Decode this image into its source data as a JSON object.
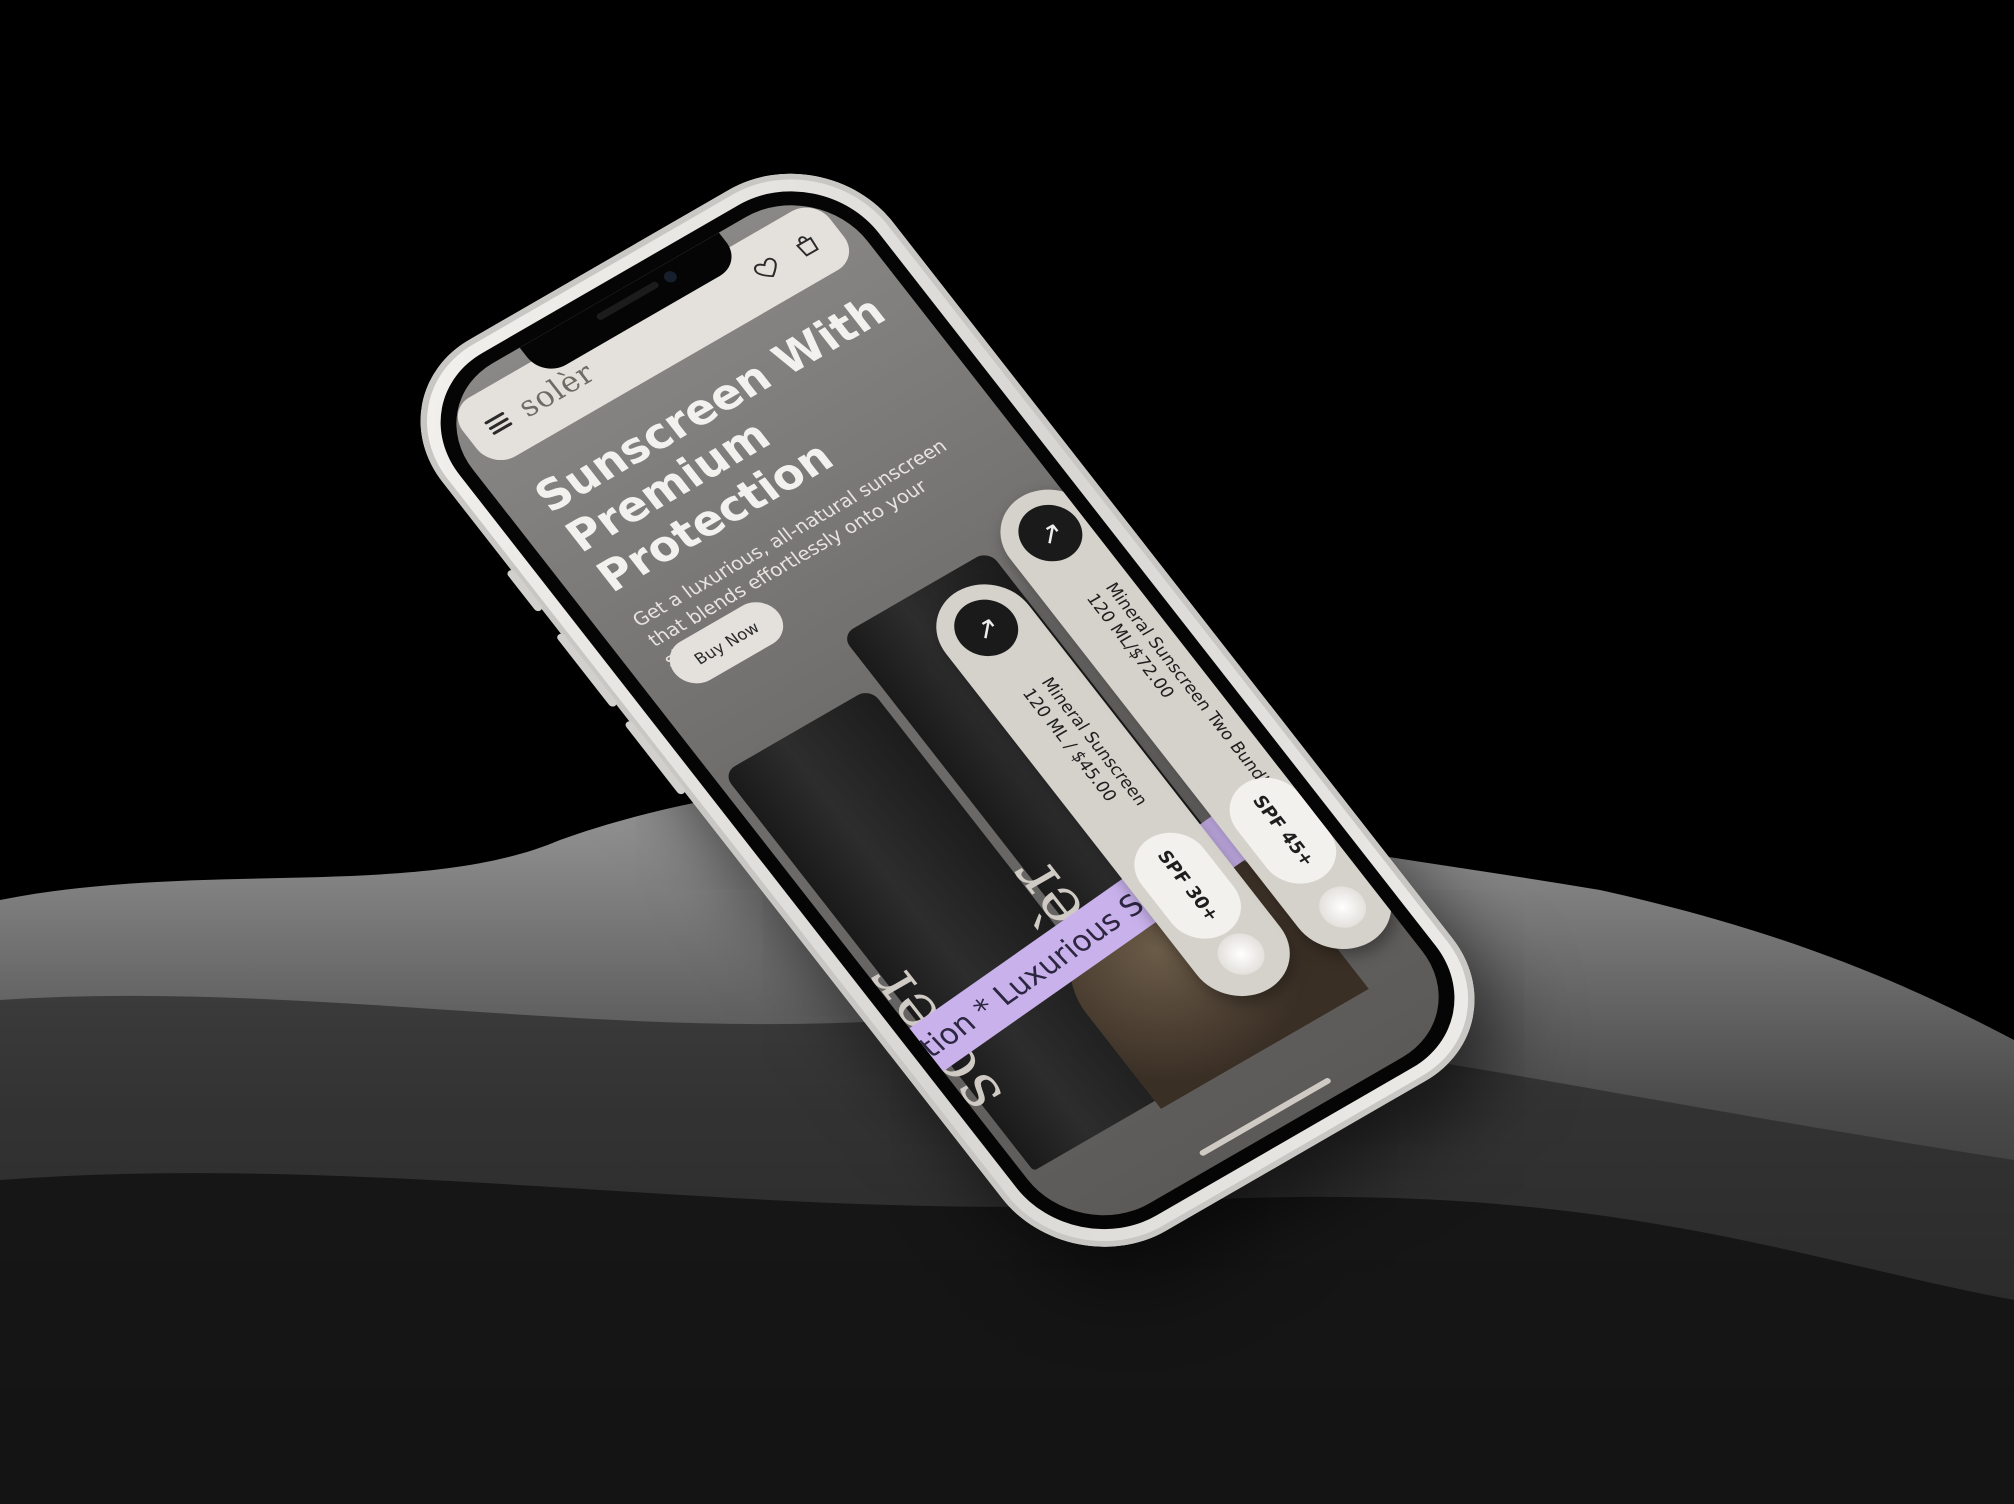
{
  "app": {
    "logo": "solèr"
  },
  "topbar": {
    "menu_icon": "hamburger-icon",
    "wishlist_icon": "heart-icon",
    "cart_icon": "shopping-bag-icon"
  },
  "hero": {
    "title": "Sunscreen With Premium Protection",
    "subtitle": "Get a luxurious, all-natural sunscreen that blends effortlessly onto your skin.",
    "cta_label": "Buy Now"
  },
  "product_brand": "solèr",
  "ribbon": {
    "text": "ction * Luxurious Sunsc"
  },
  "products": [
    {
      "name": "Mineral Sunscreen",
      "size_price": "120 ML / $45.00",
      "spf": "SPF 30+",
      "arrow_icon": "arrow-up-right-icon"
    },
    {
      "name": "Mineral Sunscreen Two Bundle",
      "size_price": "120 ML/$72.00",
      "spf": "SPF 45+",
      "arrow_icon": "arrow-up-right-icon"
    }
  ],
  "colors": {
    "background": "#000000",
    "phone_frame": "#e9e7e3",
    "topbar": "#e4e1dc",
    "accent_ribbon": "#c9b2ec",
    "tube": "#1f1f1f"
  }
}
